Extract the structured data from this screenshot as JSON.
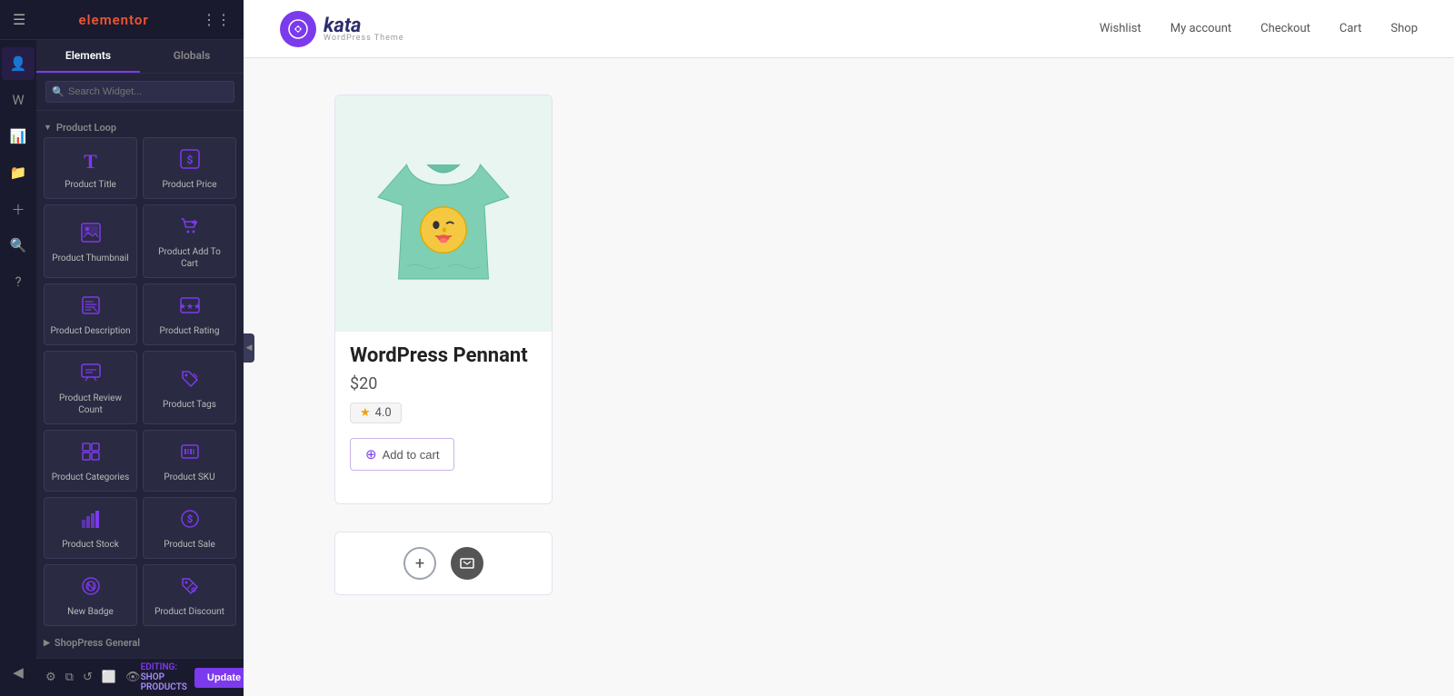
{
  "sidebar": {
    "brand": "elementor",
    "tabs": [
      {
        "label": "Elements",
        "active": true
      },
      {
        "label": "Globals",
        "active": false
      }
    ],
    "search_placeholder": "Search Widget...",
    "sections": [
      {
        "id": "product-loop",
        "label": "Product Loop",
        "widgets": [
          {
            "id": "product-title",
            "label": "Product Title",
            "icon": "T"
          },
          {
            "id": "product-price",
            "label": "Product Price",
            "icon": "$"
          },
          {
            "id": "product-thumbnail",
            "label": "Product Thumbnail",
            "icon": "🖼"
          },
          {
            "id": "product-add-to-cart",
            "label": "Product Add To Cart",
            "icon": "🛍"
          },
          {
            "id": "product-description",
            "label": "Product Description",
            "icon": "📝"
          },
          {
            "id": "product-rating",
            "label": "Product Rating",
            "icon": "⭐"
          },
          {
            "id": "product-review-count",
            "label": "Product Review Count",
            "icon": "💬"
          },
          {
            "id": "product-tags",
            "label": "Product Tags",
            "icon": "🏷"
          },
          {
            "id": "product-categories",
            "label": "Product Categories",
            "icon": "📦"
          },
          {
            "id": "product-sku",
            "label": "Product SKU",
            "icon": "🗃"
          },
          {
            "id": "product-stock",
            "label": "Product Stock",
            "icon": "📊"
          },
          {
            "id": "product-sale",
            "label": "Product Sale",
            "icon": "💲"
          },
          {
            "id": "new-badge",
            "label": "New Badge",
            "icon": "🏅"
          },
          {
            "id": "product-discount",
            "label": "Product Discount",
            "icon": "🛒"
          }
        ]
      },
      {
        "id": "shoppress-general",
        "label": "ShopPress General"
      }
    ],
    "editing_label": "Editing:",
    "editing_context": "SHOP PRODUCTS",
    "update_btn": "Update"
  },
  "navbar": {
    "logo_icon": "♿",
    "logo_text": "kata",
    "logo_sub": "WordPress Theme",
    "links": [
      "Wishlist",
      "My account",
      "Checkout",
      "Cart",
      "Shop"
    ]
  },
  "product": {
    "title": "WordPress Pennant",
    "price": "$20",
    "rating": "4.0",
    "add_to_cart_label": "Add to cart"
  },
  "colors": {
    "accent": "#7c3aed",
    "sidebar_bg": "#1a1a2e",
    "panel_bg": "#23233a"
  }
}
